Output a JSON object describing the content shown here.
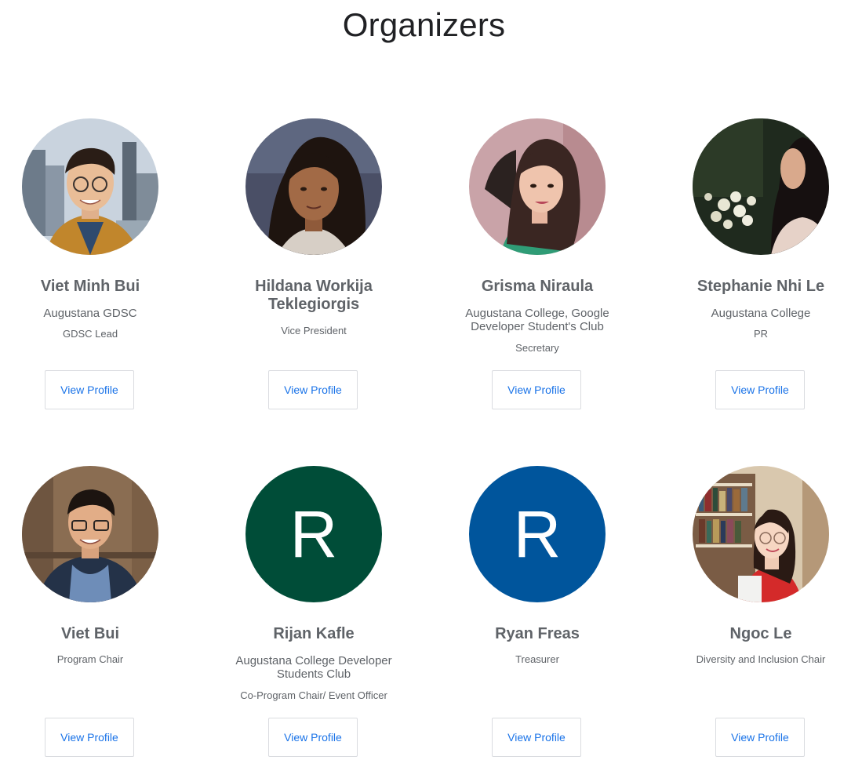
{
  "page": {
    "title": "Organizers"
  },
  "organizers": [
    {
      "name": "Viet Minh Bui",
      "company": "Augustana GDSC",
      "role": "GDSC Lead",
      "button": "View Profile"
    },
    {
      "name": "Hildana Workija Teklegiorgis",
      "company": "",
      "role": "Vice President",
      "button": "View Profile"
    },
    {
      "name": "Grisma Niraula",
      "company": "Augustana College, Google Developer Student's Club",
      "role": "Secretary",
      "button": "View Profile"
    },
    {
      "name": "Stephanie Nhi Le",
      "company": "Augustana College",
      "role": "PR",
      "button": "View Profile"
    },
    {
      "name": "Viet Bui",
      "company": "",
      "role": "Program Chair",
      "button": "View Profile"
    },
    {
      "name": "Rijan Kafle",
      "company": "Augustana College Developer Students Club",
      "role": "Co-Program Chair/ Event Officer",
      "button": "View Profile",
      "avatar_letter": "R",
      "avatar_color": "#004d38"
    },
    {
      "name": "Ryan Freas",
      "company": "",
      "role": "Treasurer",
      "button": "View Profile",
      "avatar_letter": "R",
      "avatar_color": "#00559c"
    },
    {
      "name": "Ngoc Le",
      "company": "",
      "role": "Diversity and Inclusion Chair",
      "button": "View Profile"
    }
  ]
}
